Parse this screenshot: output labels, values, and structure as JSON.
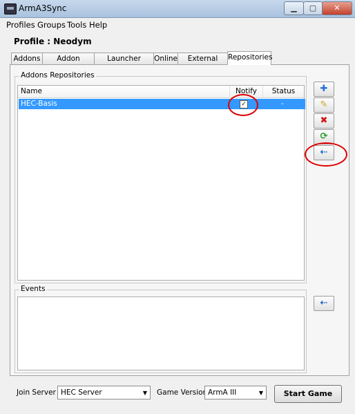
{
  "window": {
    "title": "ArmA3Sync",
    "controls": [
      "minimize-icon",
      "maximize-icon",
      "close-icon"
    ]
  },
  "menu": [
    "Profiles",
    "Groups",
    "Tools",
    "Help"
  ],
  "profile": {
    "label": "Profile : Neodym"
  },
  "tabs": [
    "Addons",
    "Addon Options",
    "Launcher Options",
    "Online",
    "External Apps",
    "Repositories"
  ],
  "active_tab": "Repositories",
  "repositories": {
    "group_title": "Addons Repositories",
    "columns": [
      "Name",
      "Notify",
      "Status"
    ],
    "rows": [
      {
        "name": "HEC-Basis",
        "notify": true,
        "status": "-"
      }
    ]
  },
  "side_buttons": [
    "add-icon",
    "edit-icon",
    "delete-icon",
    "sync-icon",
    "connect-icon"
  ],
  "events": {
    "group_title": "Events",
    "button_icon": "connect-icon"
  },
  "footer": {
    "join_server_label": "Join Server",
    "join_server_value": "HEC Server",
    "game_version_label": "Game Version",
    "game_version_value": "ArmA III",
    "start_game_label": "Start Game"
  },
  "annotation_color": "#e00000",
  "selection_color": "#3399ff"
}
